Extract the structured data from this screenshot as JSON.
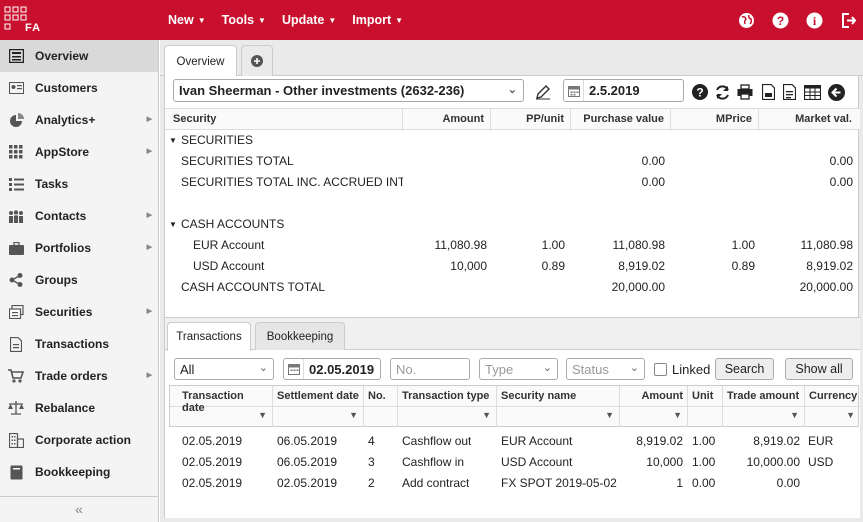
{
  "app": {
    "logo_text": "FA"
  },
  "topmenu": [
    {
      "label": "New"
    },
    {
      "label": "Tools"
    },
    {
      "label": "Update"
    },
    {
      "label": "Import"
    }
  ],
  "topicons": [
    "globe-icon",
    "help-icon",
    "info-icon",
    "logout-icon"
  ],
  "sidebar": {
    "items": [
      {
        "label": "Overview",
        "icon": "overview-icon",
        "active": true,
        "arrow": false
      },
      {
        "label": "Customers",
        "icon": "customers-icon",
        "arrow": false
      },
      {
        "label": "Analytics+",
        "icon": "analytics-icon",
        "arrow": true
      },
      {
        "label": "AppStore",
        "icon": "appstore-icon",
        "arrow": true
      },
      {
        "label": "Tasks",
        "icon": "tasks-icon",
        "arrow": false
      },
      {
        "label": "Contacts",
        "icon": "contacts-icon",
        "arrow": true
      },
      {
        "label": "Portfolios",
        "icon": "portfolios-icon",
        "arrow": true
      },
      {
        "label": "Groups",
        "icon": "groups-icon",
        "arrow": false
      },
      {
        "label": "Securities",
        "icon": "securities-icon",
        "arrow": true
      },
      {
        "label": "Transactions",
        "icon": "transactions-icon",
        "arrow": false
      },
      {
        "label": "Trade orders",
        "icon": "trade-orders-icon",
        "arrow": true
      },
      {
        "label": "Rebalance",
        "icon": "rebalance-icon",
        "arrow": false
      },
      {
        "label": "Corporate action",
        "icon": "corporate-action-icon",
        "arrow": false
      },
      {
        "label": "Bookkeeping",
        "icon": "bookkeeping-icon",
        "arrow": false
      }
    ],
    "collapse": "«"
  },
  "tabs": {
    "overview": "Overview",
    "add": "+"
  },
  "toolbar": {
    "portfolio": "Ivan Sheerman - Other investments (2632-236)",
    "date": "2.5.2019"
  },
  "holdings": {
    "columns": {
      "security": "Security",
      "amount": "Amount",
      "pp_unit": "PP/unit",
      "purchase_value": "Purchase value",
      "mprice": "MPrice",
      "market_val": "Market val."
    },
    "rows": [
      {
        "kind": "group",
        "security": "SECURITIES"
      },
      {
        "kind": "total",
        "security": "SECURITIES TOTAL",
        "purchase_value": "0.00",
        "market_val": "0.00"
      },
      {
        "kind": "total",
        "security": "SECURITIES TOTAL INC. ACCRUED INTEREST",
        "purchase_value": "0.00",
        "market_val": "0.00"
      },
      {
        "kind": "blank"
      },
      {
        "kind": "group",
        "security": "CASH ACCOUNTS"
      },
      {
        "kind": "item",
        "security": "EUR Account",
        "amount": "11,080.98",
        "pp_unit": "1.00",
        "purchase_value": "11,080.98",
        "mprice": "1.00",
        "market_val": "11,080.98"
      },
      {
        "kind": "item",
        "security": "USD Account",
        "amount": "10,000",
        "pp_unit": "0.89",
        "purchase_value": "8,919.02",
        "mprice": "0.89",
        "market_val": "8,919.02"
      },
      {
        "kind": "total",
        "security": "CASH ACCOUNTS TOTAL",
        "purchase_value": "20,000.00",
        "market_val": "20,000.00"
      }
    ]
  },
  "transactions": {
    "tabs": {
      "transactions": "Transactions",
      "bookkeeping": "Bookkeeping"
    },
    "filters": {
      "scope": "All",
      "date": "02.05.2019",
      "no_placeholder": "No.",
      "type_placeholder": "Type",
      "status_placeholder": "Status",
      "linked_label": "Linked",
      "search_button": "Search",
      "show_all_button": "Show all"
    },
    "columns": {
      "transaction_date": "Transaction date",
      "settlement_date": "Settlement date",
      "no": "No.",
      "transaction_type": "Transaction type",
      "security_name": "Security name",
      "amount": "Amount",
      "unit": "Unit",
      "trade_amount": "Trade amount",
      "currency": "Currency"
    },
    "rows": [
      {
        "transaction_date": "02.05.2019",
        "settlement_date": "06.05.2019",
        "no": "4",
        "transaction_type": "Cashflow out",
        "security_name": "EUR Account",
        "amount": "8,919.02",
        "unit": "1.00",
        "trade_amount": "8,919.02",
        "currency": "EUR"
      },
      {
        "transaction_date": "02.05.2019",
        "settlement_date": "06.05.2019",
        "no": "3",
        "transaction_type": "Cashflow in",
        "security_name": "USD Account",
        "amount": "10,000",
        "unit": "1.00",
        "trade_amount": "10,000.00",
        "currency": "USD"
      },
      {
        "transaction_date": "02.05.2019",
        "settlement_date": "02.05.2019",
        "no": "2",
        "transaction_type": "Add contract",
        "security_name": "FX SPOT 2019-05-02:",
        "amount": "1",
        "unit": "0.00",
        "trade_amount": "0.00",
        "currency": ""
      }
    ]
  },
  "colors": {
    "brand": "#c8102e",
    "sidebar_bg": "#f4f4f4",
    "active_item": "#d9d9d9"
  }
}
